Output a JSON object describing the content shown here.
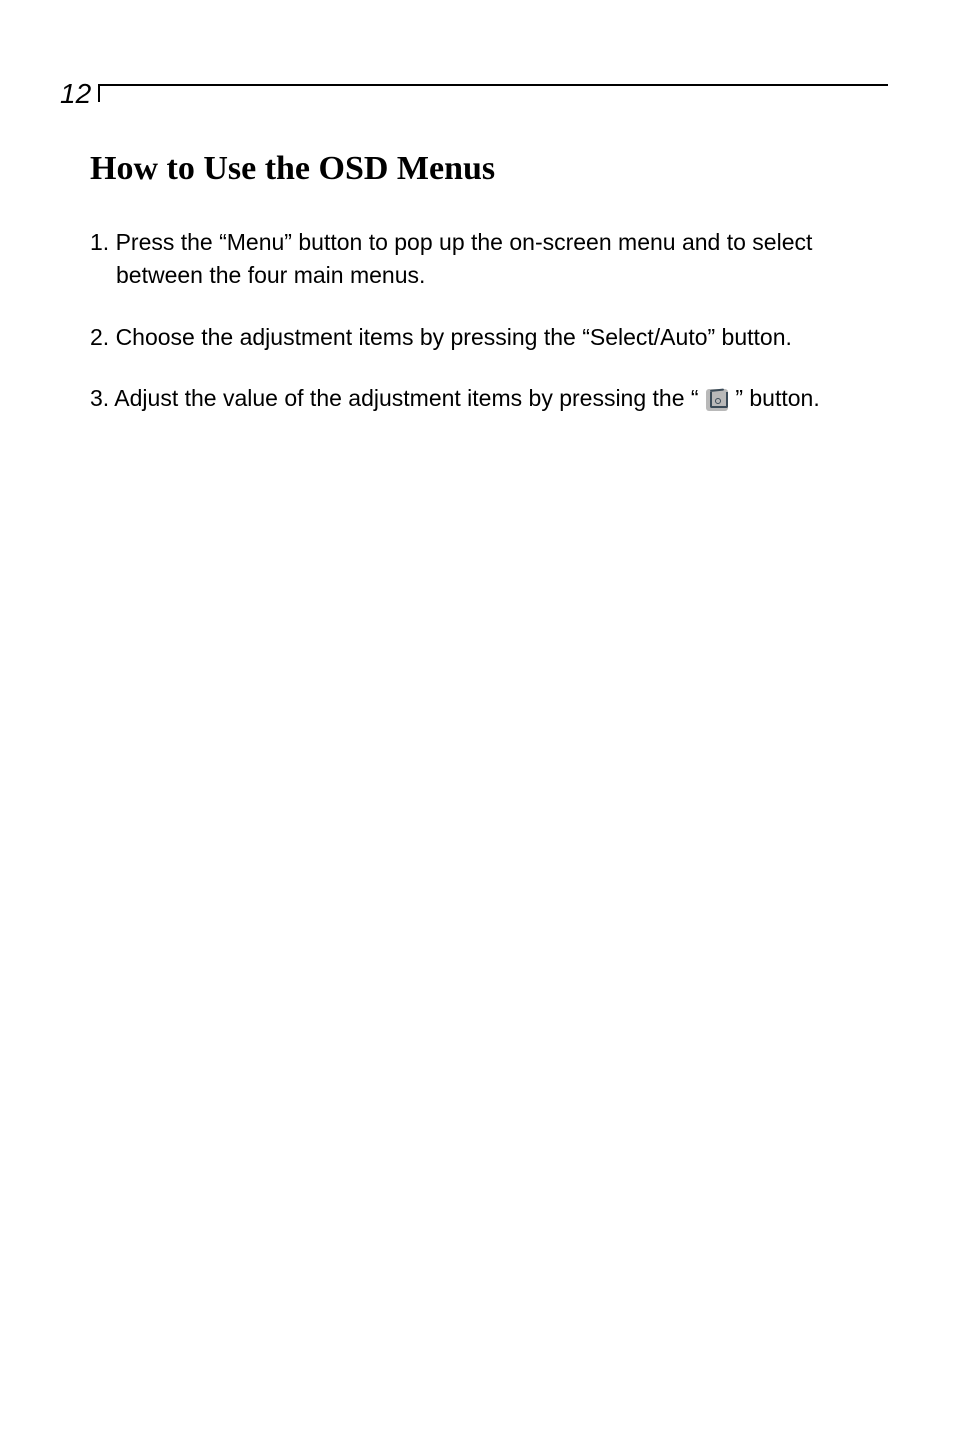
{
  "page_number": "12",
  "title": "How to Use the OSD Menus",
  "steps": {
    "s1_line1": "1. Press the “Menu” button to pop up the on-screen menu and to select",
    "s1_line2": "between the four main menus.",
    "s2": "2. Choose the adjustment items by pressing  the “Select/Auto” button.",
    "s3_prefix": "3. Adjust the value of the adjustment items by pressing the “",
    "s3_suffix": "” button."
  },
  "icon_name": "adjust-button-icon"
}
